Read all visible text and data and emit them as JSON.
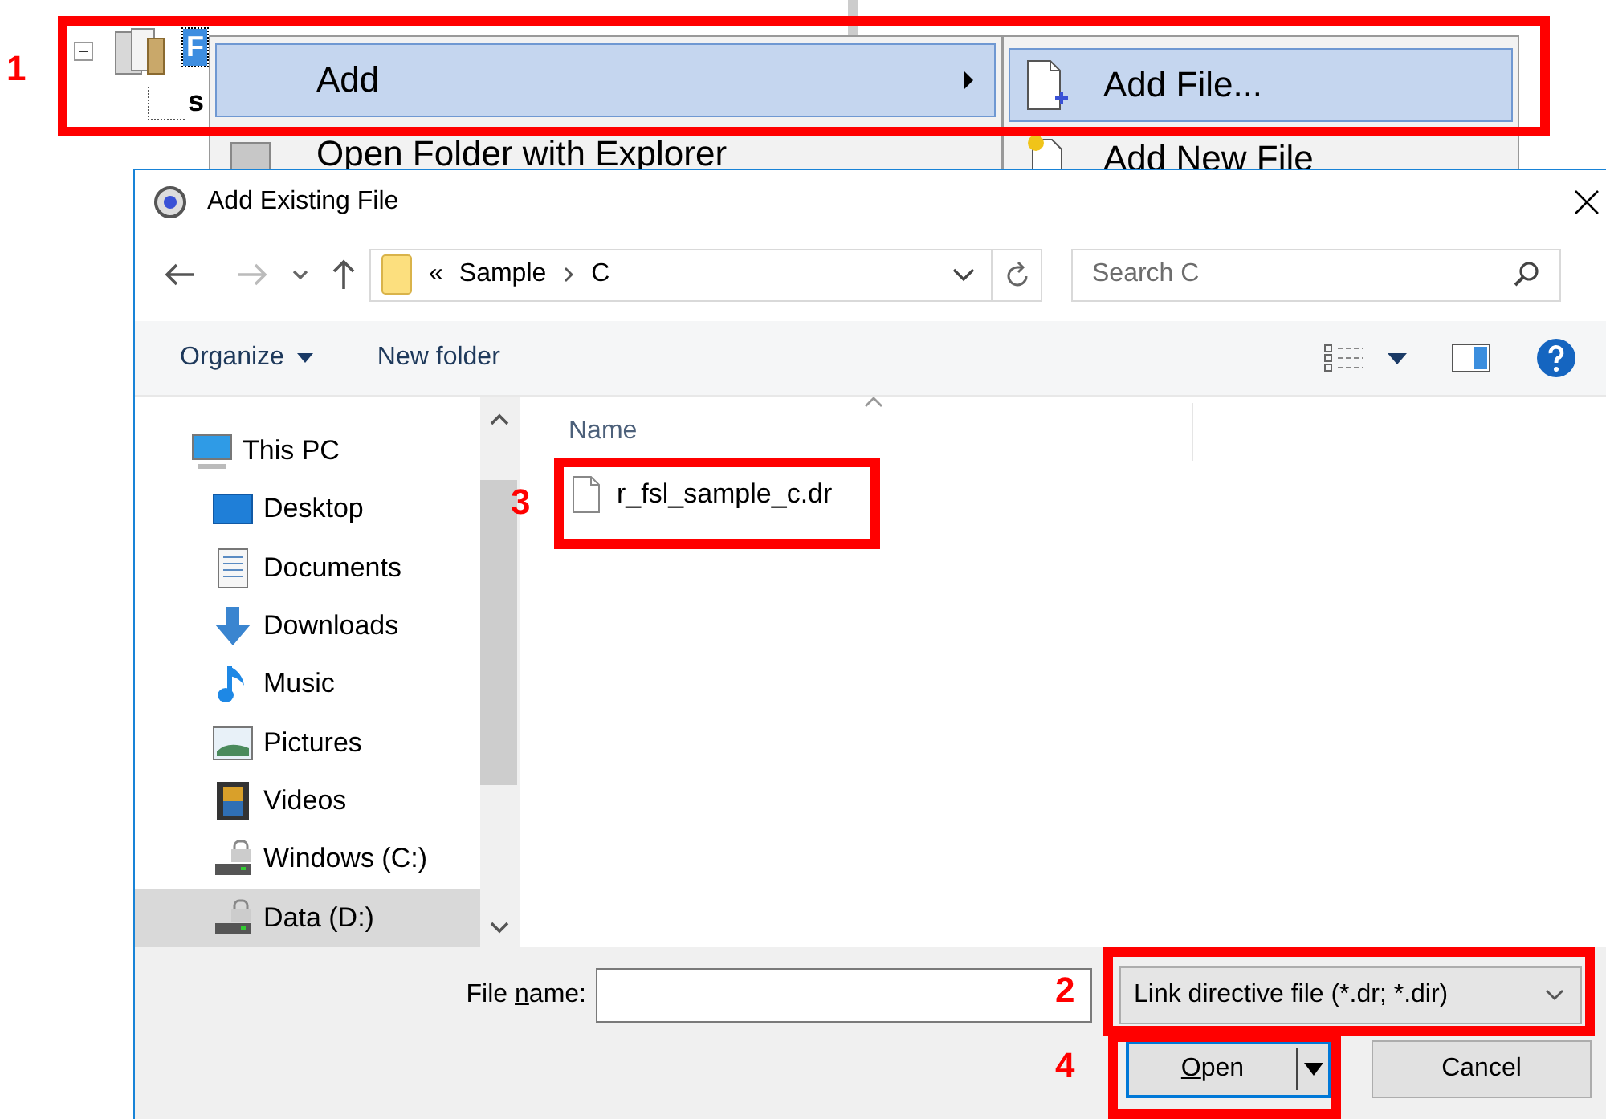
{
  "tree": {
    "items": [
      {
        "label": "F",
        "selected": true
      },
      {
        "label": "s",
        "selected": false
      }
    ]
  },
  "context_menu": {
    "items": [
      {
        "label": "Add",
        "selected": true,
        "has_submenu": true
      },
      {
        "label": "Open Folder with Explorer",
        "selected": false,
        "has_submenu": false
      }
    ]
  },
  "submenu": {
    "items": [
      {
        "label": "Add File...",
        "selected": true
      },
      {
        "label": "Add New File",
        "selected": false
      }
    ]
  },
  "dialog": {
    "title": "Add Existing File",
    "address": {
      "overflow": "«",
      "path": [
        "Sample",
        "C"
      ]
    },
    "search": {
      "placeholder": "Search C"
    },
    "toolbar": {
      "organize": "Organize",
      "new_folder": "New folder"
    },
    "nav_items": [
      {
        "label": "This PC",
        "kind": "pc",
        "selected": false
      },
      {
        "label": "Desktop",
        "kind": "desktop",
        "selected": false
      },
      {
        "label": "Documents",
        "kind": "documents",
        "selected": false
      },
      {
        "label": "Downloads",
        "kind": "downloads",
        "selected": false
      },
      {
        "label": "Music",
        "kind": "music",
        "selected": false
      },
      {
        "label": "Pictures",
        "kind": "pictures",
        "selected": false
      },
      {
        "label": "Videos",
        "kind": "videos",
        "selected": false
      },
      {
        "label": "Windows (C:)",
        "kind": "drive",
        "selected": false
      },
      {
        "label": "Data (D:)",
        "kind": "drive",
        "selected": true
      }
    ],
    "columns": [
      "Name"
    ],
    "files": [
      {
        "name": "r_fsl_sample_c.dr"
      }
    ],
    "file_name": {
      "label": "File **n**ame:"
    },
    "file_type": "Link directive file (*.dr; *.dir)",
    "buttons": {
      "open": "**O**pen",
      "cancel": "Cancel"
    }
  },
  "annotations": [
    {
      "label": "1"
    },
    {
      "label": "2"
    },
    {
      "label": "3"
    },
    {
      "label": "4"
    }
  ]
}
